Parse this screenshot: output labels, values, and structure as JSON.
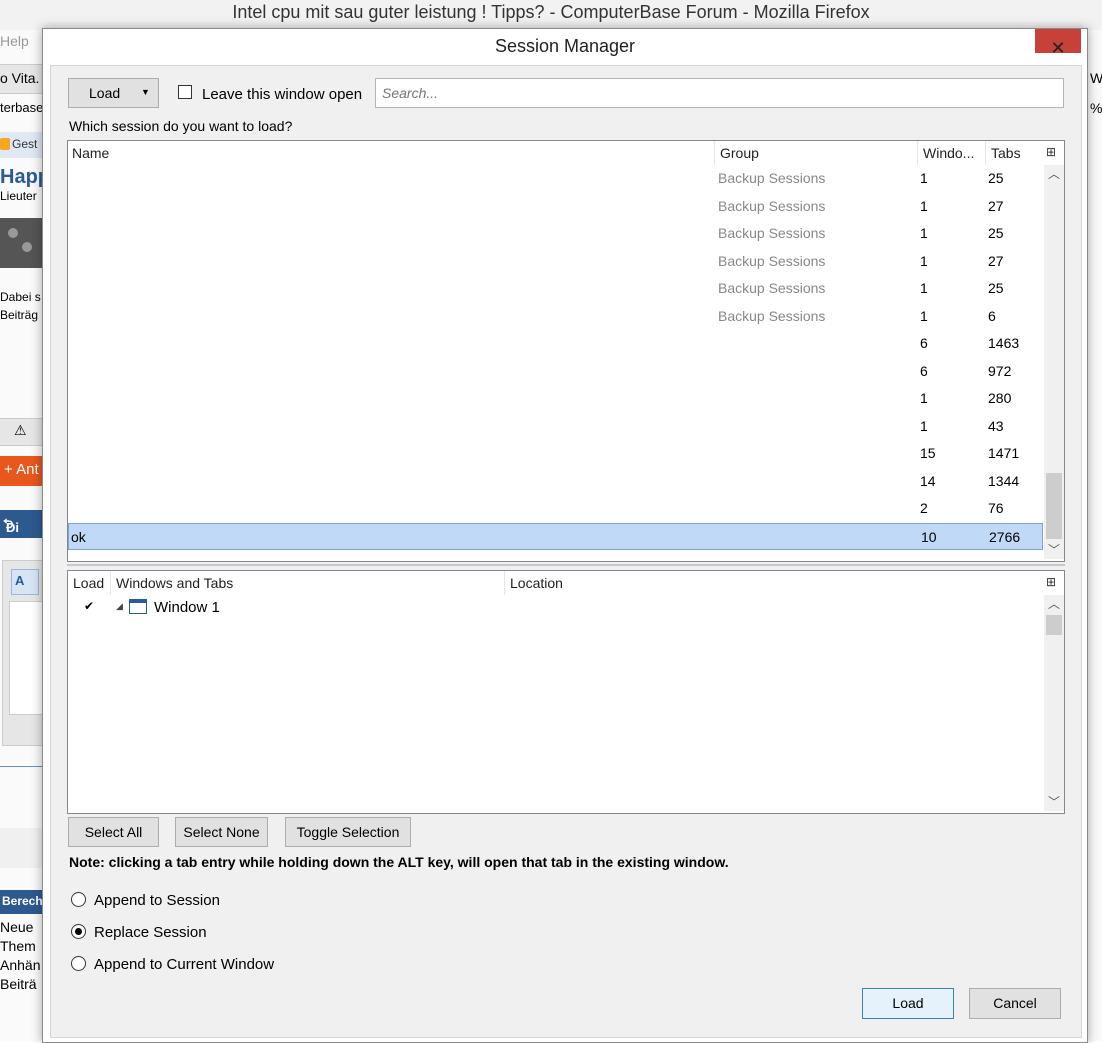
{
  "browser": {
    "window_title": "Intel cpu mit sau guter leistung ! Tipps? - ComputerBase Forum - Mozilla Firefox",
    "left_fragments": {
      "help": "Help",
      "tab": "o Vita.",
      "url": "terbase",
      "gest": "Gest",
      "happ": "Happ",
      "lieut": "Lieuter",
      "dabei_1": "Dabei s",
      "dabei_2": "Beiträg",
      "antw": "+ Ant",
      "dir": "Di",
      "editor_icon": "A",
      "berech": "Berech",
      "list": [
        "Neue",
        "Them",
        "Anhän",
        "Beiträ"
      ]
    },
    "right_fragments": {
      "w": "W",
      "p": "%"
    }
  },
  "dialog": {
    "title": "Session Manager",
    "close_symbol": "✕",
    "load_menu_label": "Load",
    "leave_open_label": "Leave this window open",
    "leave_open_checked": false,
    "search_placeholder": "Search...",
    "question": "Which session do you want to load?",
    "session_columns": {
      "name": "Name",
      "group": "Group",
      "windows": "Windo...",
      "tabs": "Tabs"
    },
    "sessions": [
      {
        "name": "",
        "group": "Backup Sessions",
        "windows": "1",
        "tabs": "25"
      },
      {
        "name": "",
        "group": "Backup Sessions",
        "windows": "1",
        "tabs": "27"
      },
      {
        "name": "",
        "group": "Backup Sessions",
        "windows": "1",
        "tabs": "25"
      },
      {
        "name": "",
        "group": "Backup Sessions",
        "windows": "1",
        "tabs": "27"
      },
      {
        "name": "",
        "group": "Backup Sessions",
        "windows": "1",
        "tabs": "25"
      },
      {
        "name": "",
        "group": "Backup Sessions",
        "windows": "1",
        "tabs": "6"
      },
      {
        "name": "",
        "group": "",
        "windows": "6",
        "tabs": "1463"
      },
      {
        "name": "",
        "group": "",
        "windows": "6",
        "tabs": "972"
      },
      {
        "name": "",
        "group": "",
        "windows": "1",
        "tabs": "280"
      },
      {
        "name": "",
        "group": "",
        "windows": "1",
        "tabs": "43"
      },
      {
        "name": "",
        "group": "",
        "windows": "15",
        "tabs": "1471"
      },
      {
        "name": "",
        "group": "",
        "windows": "14",
        "tabs": "1344"
      },
      {
        "name": "",
        "group": "",
        "windows": "2",
        "tabs": "76"
      },
      {
        "name": "ok",
        "group": "",
        "windows": "10",
        "tabs": "2766",
        "selected": true
      }
    ],
    "tree_columns": {
      "load": "Load",
      "windows_tabs": "Windows and Tabs",
      "location": "Location"
    },
    "tree_items": [
      {
        "checked": true,
        "label": "Window 1",
        "expanded": true
      }
    ],
    "select_all_label": "Select All",
    "select_none_label": "Select None",
    "toggle_selection_label": "Toggle Selection",
    "note": "Note: clicking a tab entry while holding down the ALT key, will open that tab in the existing window.",
    "options": [
      {
        "label": "Append to Session",
        "selected": false
      },
      {
        "label": "Replace Session",
        "selected": true
      },
      {
        "label": "Append to Current Window",
        "selected": false
      }
    ],
    "load_button": "Load",
    "cancel_button": "Cancel"
  },
  "colors": {
    "selection": "#bfd9f6",
    "close_button": "#c7403a",
    "group_text": "#888888"
  }
}
